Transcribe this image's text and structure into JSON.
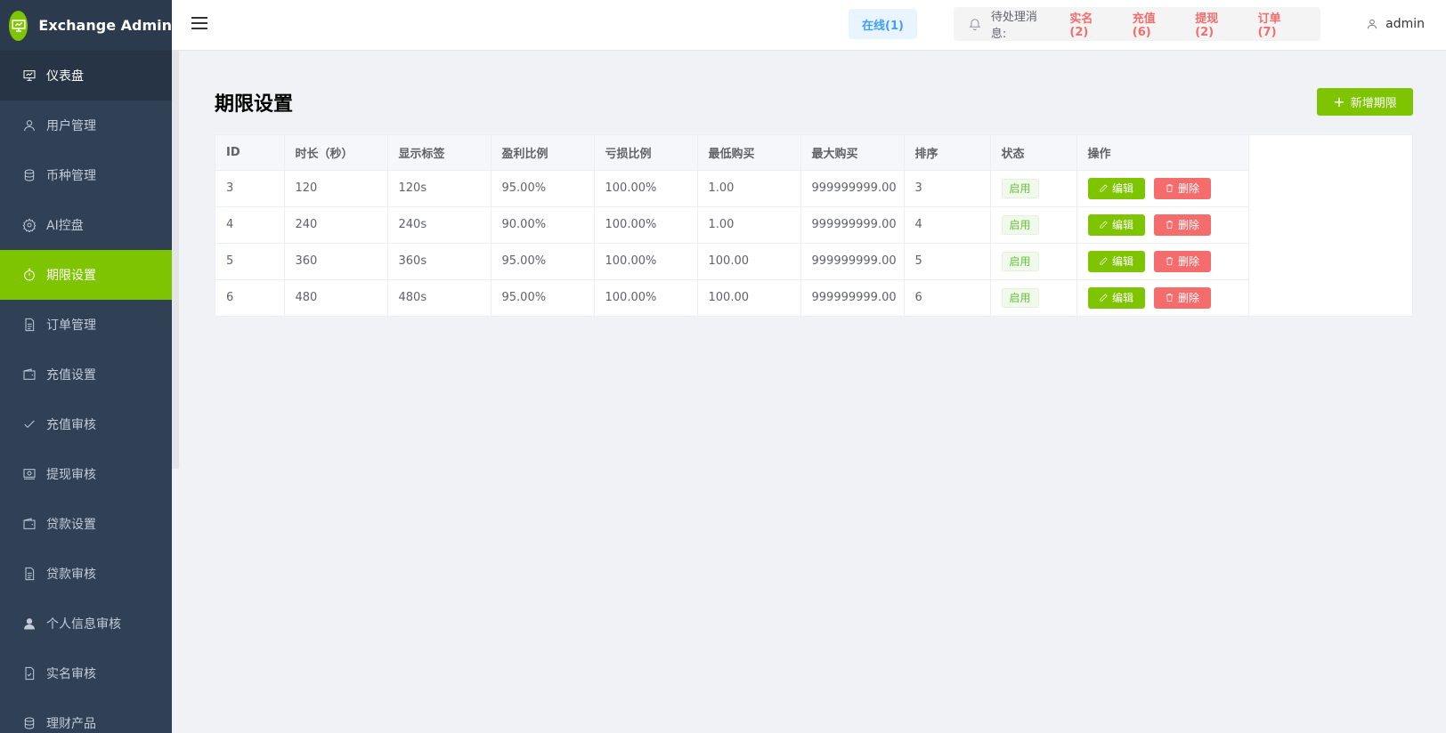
{
  "brand": {
    "title": "Exchange Admin",
    "logo_icon": "presentation-icon"
  },
  "sidebar": {
    "items": [
      {
        "label": "仪表盘",
        "icon": "dashboard-icon"
      },
      {
        "label": "用户管理",
        "icon": "user-icon"
      },
      {
        "label": "币种管理",
        "icon": "database-icon"
      },
      {
        "label": "AI控盘",
        "icon": "gear-icon"
      },
      {
        "label": "期限设置",
        "icon": "stopwatch-icon"
      },
      {
        "label": "订单管理",
        "icon": "document-icon"
      },
      {
        "label": "充值设置",
        "icon": "wallet-icon"
      },
      {
        "label": "充值审核",
        "icon": "check-icon"
      },
      {
        "label": "提现审核",
        "icon": "money-icon"
      },
      {
        "label": "贷款设置",
        "icon": "wallet-icon"
      },
      {
        "label": "贷款审核",
        "icon": "document-icon"
      },
      {
        "label": "个人信息审核",
        "icon": "person-filled-icon"
      },
      {
        "label": "实名审核",
        "icon": "document-check-icon"
      },
      {
        "label": "理财产品",
        "icon": "database-icon"
      }
    ],
    "active_label": "期限设置"
  },
  "header": {
    "online": "在线(1)",
    "notice_label": "待处理消息:",
    "notices": [
      "实名(2)",
      "充值(6)",
      "提现(2)",
      "订单(7)"
    ],
    "username": "admin"
  },
  "page": {
    "title": "期限设置",
    "add_button": "新增期限"
  },
  "table": {
    "columns": [
      "ID",
      "时长（秒）",
      "显示标签",
      "盈利比例",
      "亏损比例",
      "最低购买",
      "最大购买",
      "排序",
      "状态",
      "操作"
    ],
    "rows": [
      [
        "3",
        "120",
        "120s",
        "95.00%",
        "100.00%",
        "1.00",
        "999999999.00",
        "3",
        "启用"
      ],
      [
        "4",
        "240",
        "240s",
        "90.00%",
        "100.00%",
        "1.00",
        "999999999.00",
        "4",
        "启用"
      ],
      [
        "5",
        "360",
        "360s",
        "95.00%",
        "100.00%",
        "100.00",
        "999999999.00",
        "5",
        "启用"
      ],
      [
        "6",
        "480",
        "480s",
        "95.00%",
        "100.00%",
        "100.00",
        "999999999.00",
        "6",
        "启用"
      ]
    ],
    "edit_label": "编辑",
    "delete_label": "删除"
  },
  "colors": {
    "accent": "#7ec400",
    "sidebar_bg": "#304156",
    "danger": "#f56c6c",
    "online": "#409eff"
  }
}
